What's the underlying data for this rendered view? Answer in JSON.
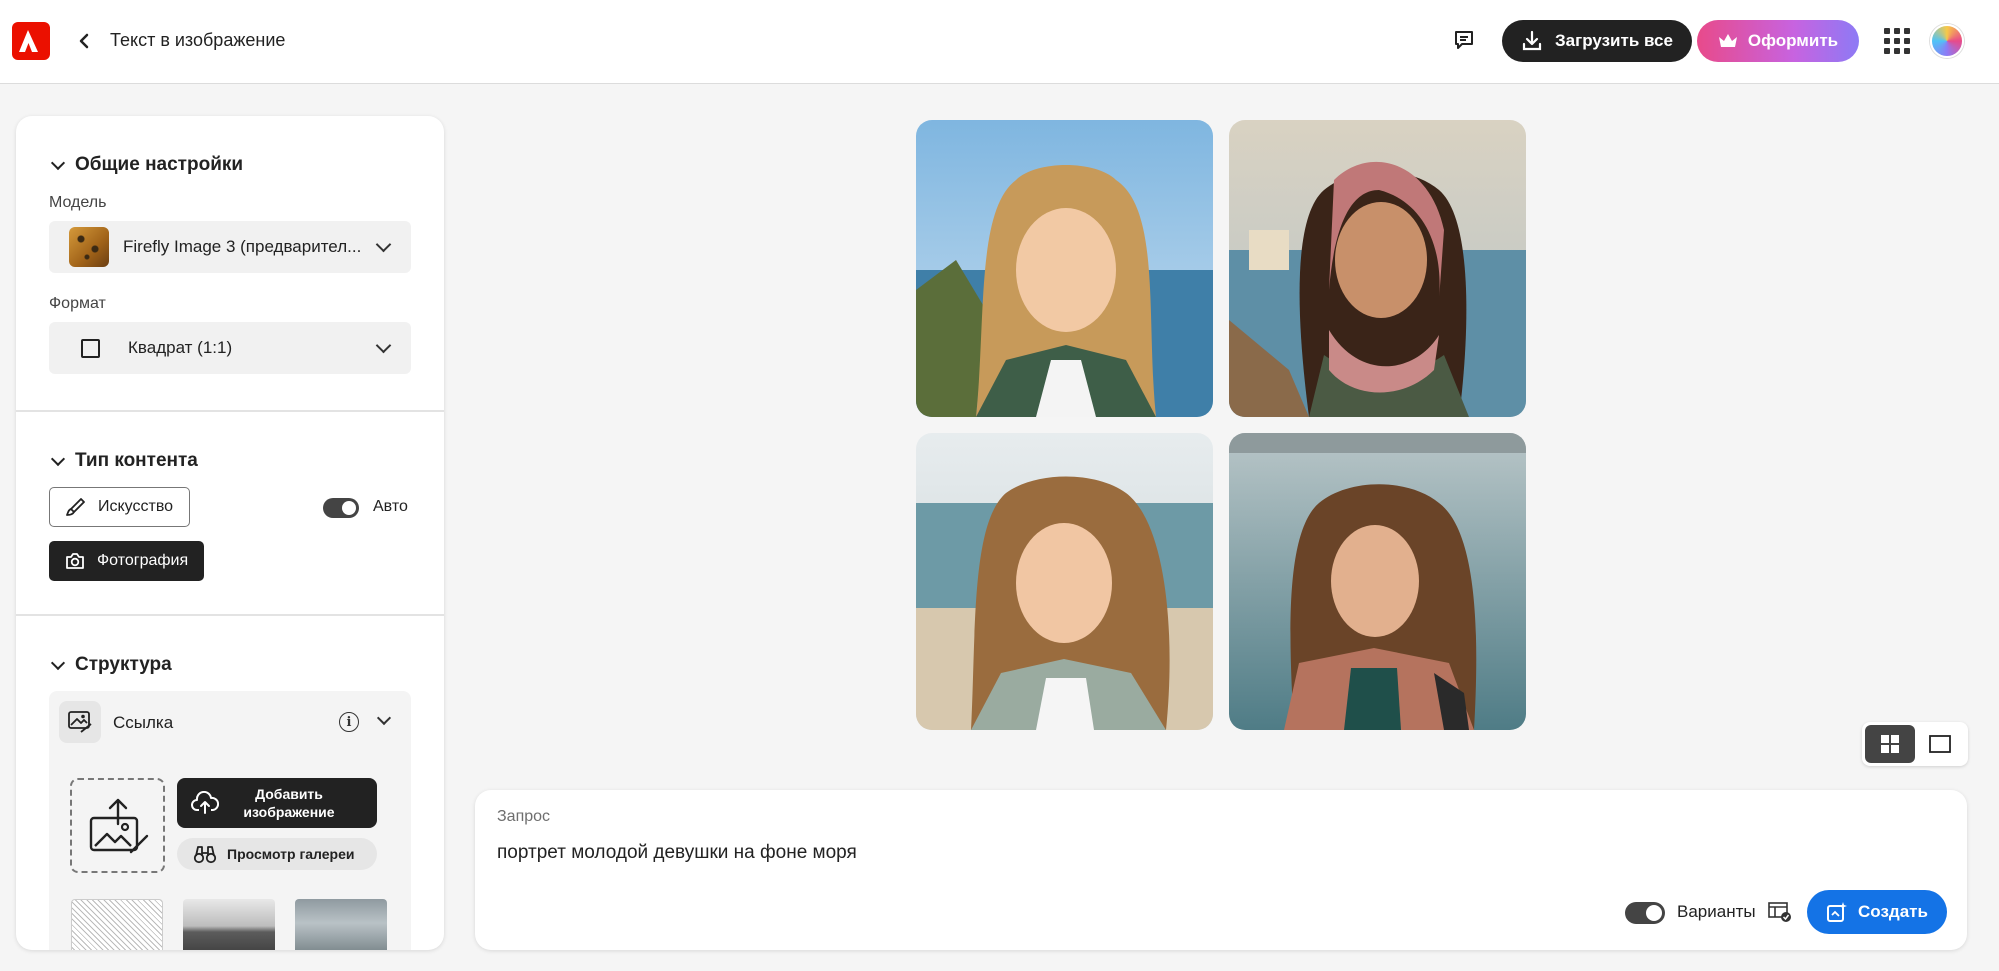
{
  "header": {
    "app_logo": "adobe-logo",
    "title": "Текст в изображение",
    "download_all_label": "Загрузить все",
    "upgrade_label": "Оформить",
    "brand_color": "#eb1000"
  },
  "sidebar": {
    "general": {
      "title": "Общие настройки",
      "model_label": "Модель",
      "model_value": "Firefly Image 3 (предварител...",
      "format_label": "Формат",
      "format_value": "Квадрат (1:1)"
    },
    "content_type": {
      "title": "Тип контента",
      "art_label": "Искусство",
      "photo_label": "Фотография",
      "auto_label": "Авто",
      "auto_on": true,
      "selected": "Фотография"
    },
    "structure": {
      "title": "Структура",
      "reference_label": "Ссылка",
      "add_image_label_line1": "Добавить",
      "add_image_label_line2": "изображение",
      "browse_gallery_label": "Просмотр галереи"
    }
  },
  "gallery": {
    "images": [
      {
        "name": "generated-image-1",
        "alt": "portrait-girl-cliff-sea"
      },
      {
        "name": "generated-image-2",
        "alt": "portrait-girl-scarf-bridge"
      },
      {
        "name": "generated-image-3",
        "alt": "portrait-girl-beach"
      },
      {
        "name": "generated-image-4",
        "alt": "portrait-girl-sea-pier"
      }
    ],
    "view_mode": "grid"
  },
  "prompt": {
    "label": "Запрос",
    "value": "портрет молодой девушки на фоне моря",
    "variants_label": "Варианты",
    "variants_on": true,
    "create_label": "Создать",
    "create_color": "#1473e6"
  }
}
